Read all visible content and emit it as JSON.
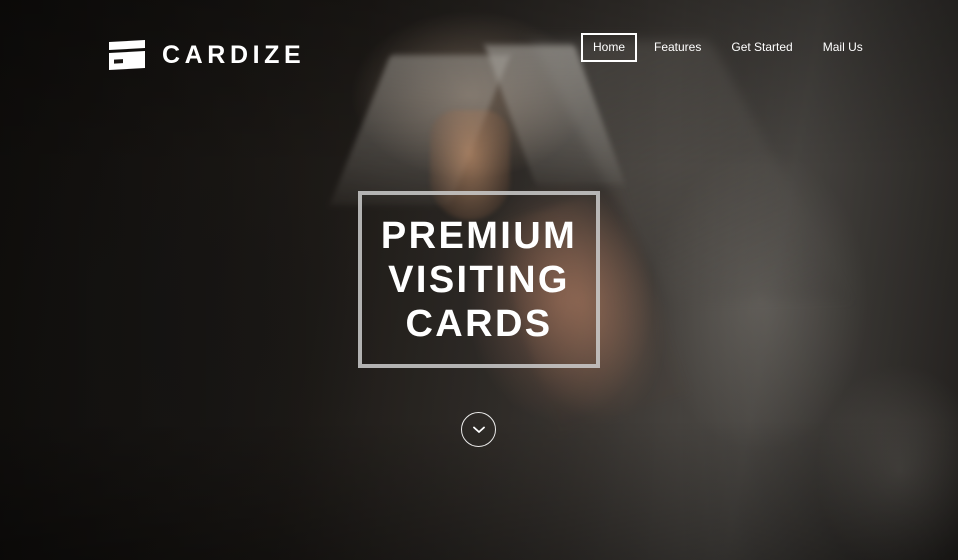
{
  "brand": {
    "name": "CARDIZE",
    "logo_icon": "cards-icon"
  },
  "nav": {
    "items": [
      {
        "label": "Home",
        "active": true
      },
      {
        "label": "Features",
        "active": false
      },
      {
        "label": "Get Started",
        "active": false
      },
      {
        "label": "Mail Us",
        "active": false
      }
    ]
  },
  "hero": {
    "title_lines": [
      "PREMIUM",
      "VISITING",
      "CARDS"
    ],
    "scroll_icon": "chevron-down-icon"
  },
  "colors": {
    "text": "#ffffff",
    "frame": "#cdcdcd",
    "background": "#141210"
  }
}
